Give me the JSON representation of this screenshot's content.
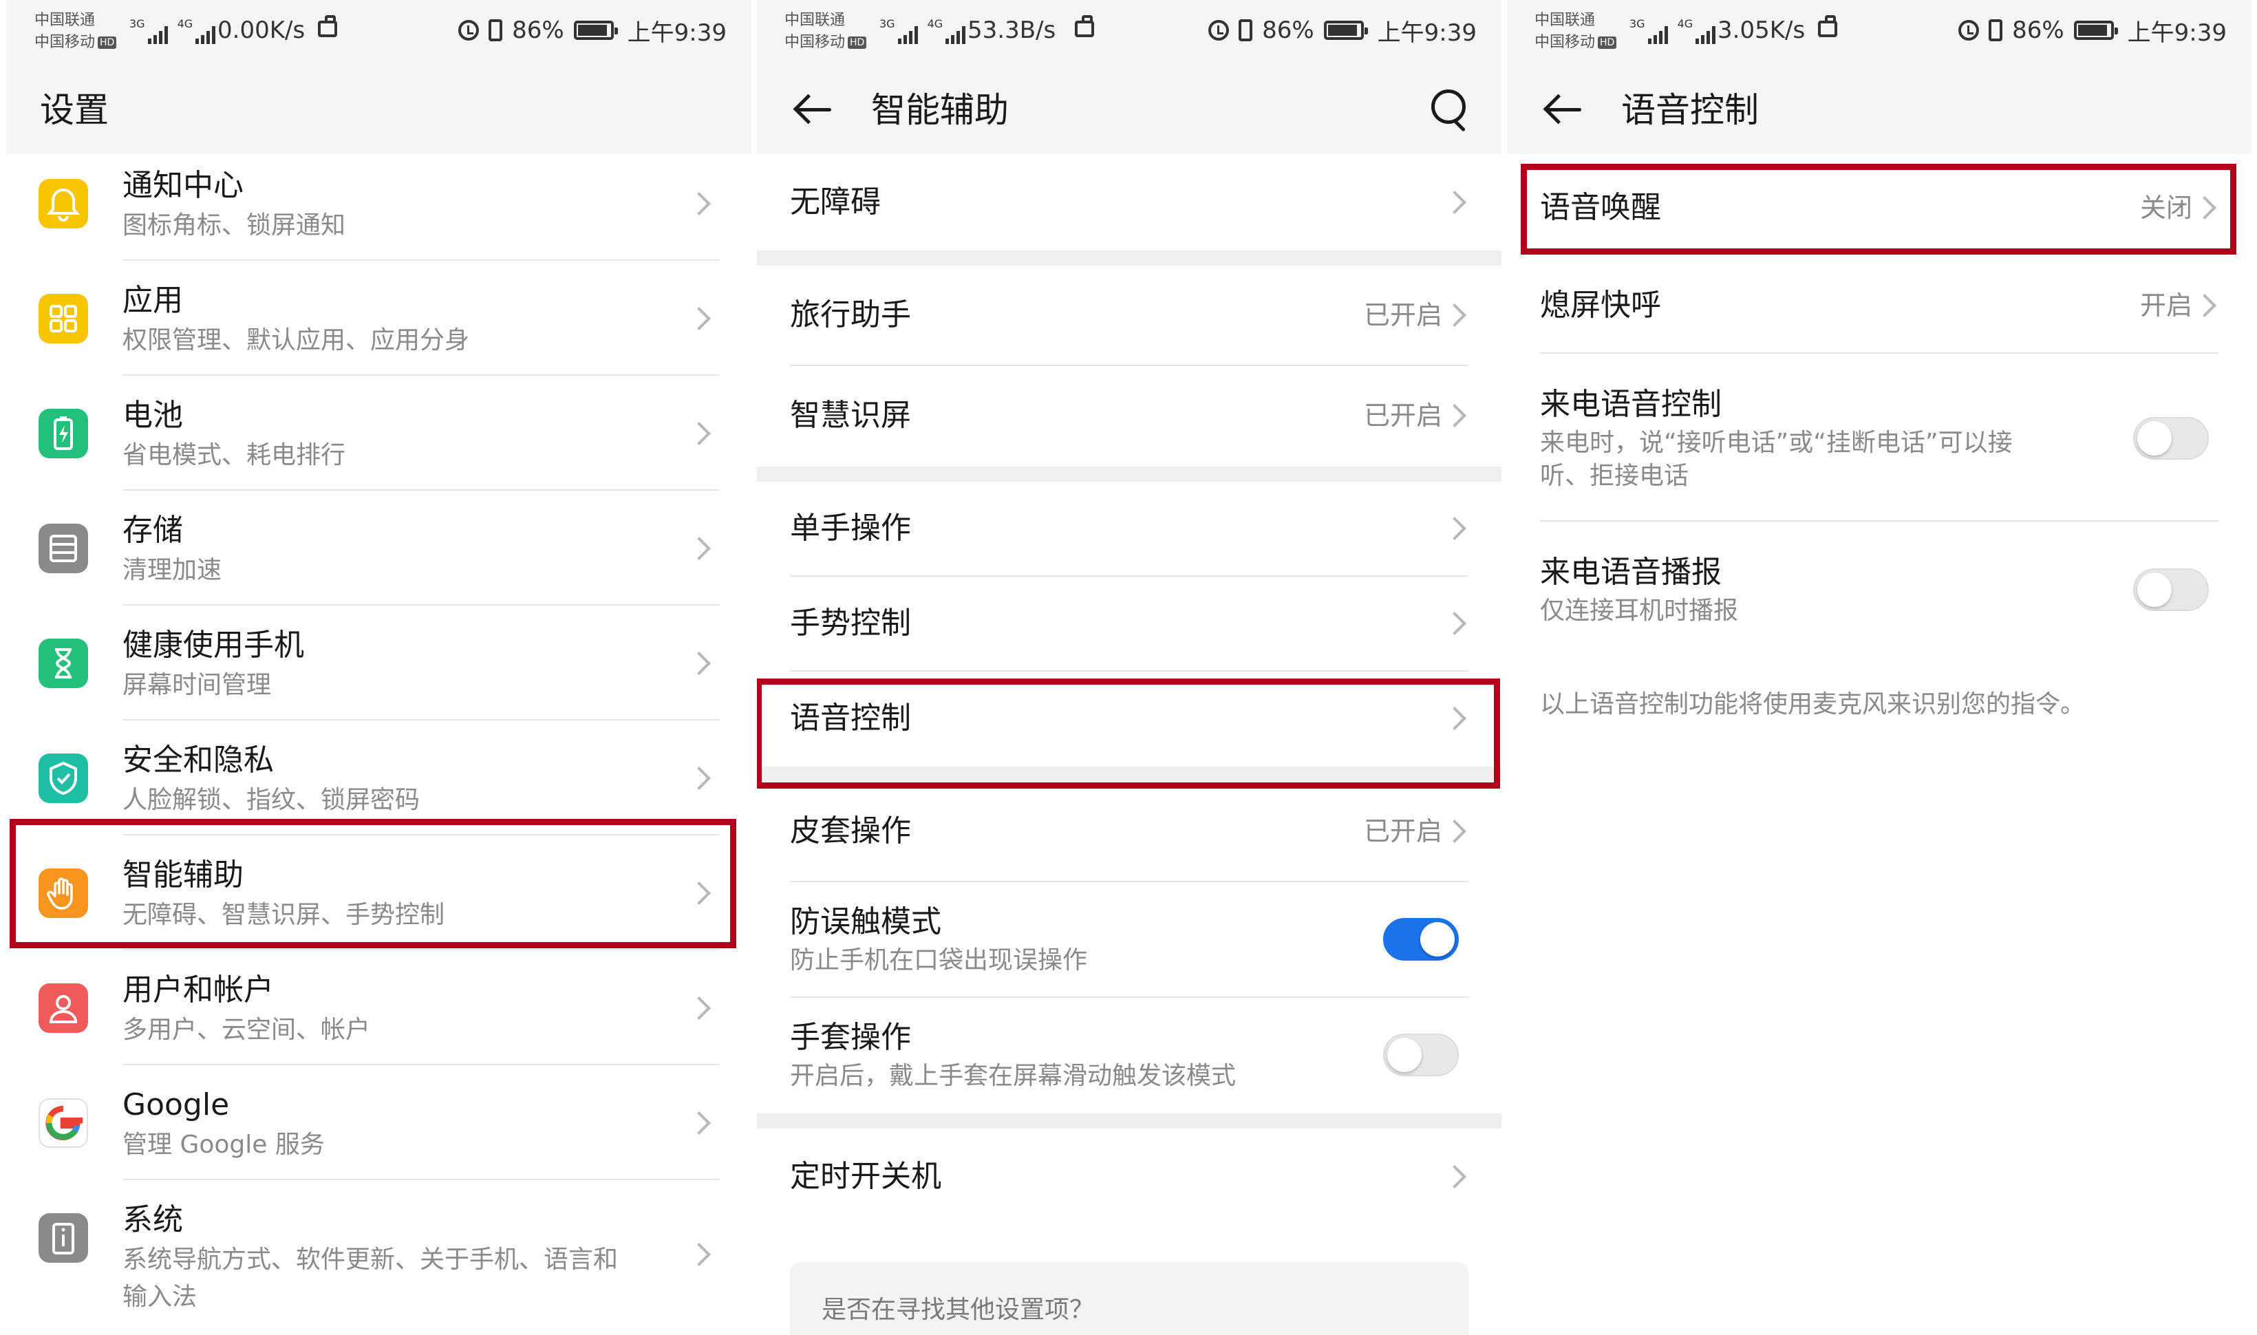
{
  "status_bars": [
    {
      "carrier_top": "中国联通",
      "carrier_bottom": "中国移动",
      "hd": "HD",
      "net1": "3G",
      "net2": "4G",
      "speed": "0.00K/s",
      "battery": "86%",
      "time": "上午9:39"
    },
    {
      "carrier_top": "中国联通",
      "carrier_bottom": "中国移动",
      "hd": "HD",
      "net1": "3G",
      "net2": "4G",
      "speed": "53.3B/s",
      "battery": "86%",
      "time": "上午9:39"
    },
    {
      "carrier_top": "中国联通",
      "carrier_bottom": "中国移动",
      "hd": "HD",
      "net1": "3G",
      "net2": "4G",
      "speed": "3.05K/s",
      "battery": "86%",
      "time": "上午9:39"
    }
  ],
  "settings": {
    "title": "设置",
    "items": [
      {
        "label": "通知中心",
        "sub": "图标角标、锁屏通知",
        "icon": "bell-icon",
        "color": "#f7c600",
        "glyph": "🔔"
      },
      {
        "label": "应用",
        "sub": "权限管理、默认应用、应用分身",
        "icon": "apps-grid-icon",
        "color": "#f7c600",
        "glyph": "▦"
      },
      {
        "label": "电池",
        "sub": "省电模式、耗电排行",
        "icon": "battery-icon",
        "color": "#22c07a",
        "glyph": "⚡"
      },
      {
        "label": "存储",
        "sub": "清理加速",
        "icon": "storage-icon",
        "color": "#8a8a8a",
        "glyph": "☰"
      },
      {
        "label": "健康使用手机",
        "sub": "屏幕时间管理",
        "icon": "hourglass-icon",
        "color": "#22c07a",
        "glyph": "⌛"
      },
      {
        "label": "安全和隐私",
        "sub": "人脸解锁、指纹、锁屏密码",
        "icon": "shield-icon",
        "color": "#1fbfa5",
        "glyph": "✓"
      },
      {
        "label": "智能辅助",
        "sub": "无障碍、智慧识屏、手势控制",
        "icon": "hand-icon",
        "color": "#f7951e",
        "glyph": "✋"
      },
      {
        "label": "用户和帐户",
        "sub": "多用户、云空间、帐户",
        "icon": "user-icon",
        "color": "#f05a5a",
        "glyph": "👤"
      },
      {
        "label": "Google",
        "sub": "管理 Google 服务",
        "icon": "google-icon",
        "color": "#4285f4",
        "glyph": "G"
      },
      {
        "label": "系统",
        "sub": "系统导航方式、软件更新、关于手机、语言和",
        "sub2": "输入法",
        "icon": "info-icon",
        "color": "#8a8a8a",
        "glyph": "i"
      }
    ]
  },
  "assist": {
    "title": "智能辅助",
    "items": [
      {
        "label": "无障碍",
        "value": ""
      },
      {
        "label": "旅行助手",
        "value": "已开启"
      },
      {
        "label": "智慧识屏",
        "value": "已开启"
      },
      {
        "label": "单手操作",
        "value": ""
      },
      {
        "label": "手势控制",
        "value": ""
      },
      {
        "label": "语音控制",
        "value": ""
      },
      {
        "label": "皮套操作",
        "value": "已开启"
      },
      {
        "label": "防误触模式",
        "sub": "防止手机在口袋出现误操作",
        "toggle": true
      },
      {
        "label": "手套操作",
        "sub": "开启后，戴上手套在屏幕滑动触发该模式",
        "toggle": false
      },
      {
        "label": "定时开关机",
        "value": ""
      }
    ],
    "search_hint": "是否在寻找其他设置项？"
  },
  "voice": {
    "title": "语音控制",
    "items": [
      {
        "label": "语音唤醒",
        "value": "关闭"
      },
      {
        "label": "熄屏快呼",
        "value": "开启"
      },
      {
        "label": "来电语音控制",
        "sub": "来电时，说“接听电话”或“挂断电话”可以接",
        "sub2": "听、拒接电话",
        "toggle": false
      },
      {
        "label": "来电语音播报",
        "sub": "仅连接耳机时播报",
        "toggle": false
      }
    ],
    "footnote": "以上语音控制功能将使用麦克风来识别您的指令。"
  },
  "colors": {
    "highlight": "#b3001b",
    "toggle_on": "#1a73e8"
  }
}
